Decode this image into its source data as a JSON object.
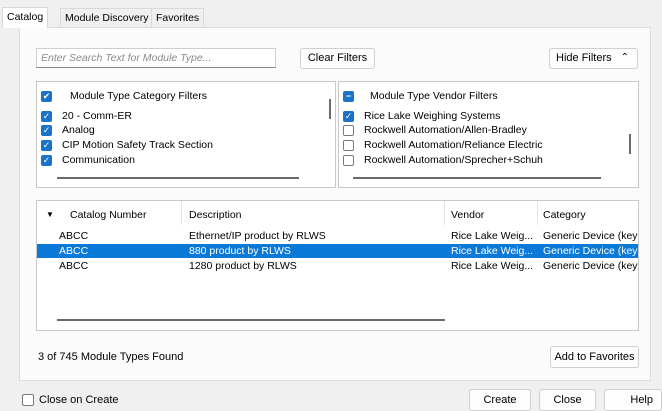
{
  "tabs": [
    "Catalog",
    "Module Discovery",
    "Favorites"
  ],
  "search": {
    "placeholder": "Enter Search Text for Module Type..."
  },
  "buttons": {
    "clear_filters": "Clear Filters",
    "hide_filters": "Hide Filters",
    "add_to_favorites": "Add to Favorites",
    "create": "Create",
    "close": "Close",
    "help": "Help"
  },
  "category_filter": {
    "header": "Module Type Category Filters",
    "items": [
      {
        "label": "20 - Comm-ER",
        "checked": true
      },
      {
        "label": "Analog",
        "checked": true
      },
      {
        "label": "CIP Motion Safety Track Section",
        "checked": true
      },
      {
        "label": "Communication",
        "checked": true
      }
    ]
  },
  "vendor_filter": {
    "header": "Module Type Vendor Filters",
    "items": [
      {
        "label": "Rice Lake Weighing Systems",
        "checked": true
      },
      {
        "label": "Rockwell Automation/Allen-Bradley",
        "checked": false
      },
      {
        "label": "Rockwell Automation/Reliance Electric",
        "checked": false
      },
      {
        "label": "Rockwell Automation/Sprecher+Schuh",
        "checked": false
      }
    ]
  },
  "table": {
    "columns": [
      "Catalog Number",
      "Description",
      "Vendor",
      "Category"
    ],
    "rows": [
      {
        "catalog": "ABCC",
        "description": "Ethernet/IP product by RLWS",
        "vendor": "Rice Lake Weig...",
        "category": "Generic Device (keya",
        "selected": false
      },
      {
        "catalog": "ABCC",
        "description": "880 product by RLWS",
        "vendor": "Rice Lake Weig...",
        "category": "Generic Device (keya",
        "selected": true
      },
      {
        "catalog": "ABCC",
        "description": "1280 product by RLWS",
        "vendor": "Rice Lake Weig...",
        "category": "Generic Device (keya",
        "selected": false
      }
    ]
  },
  "status_text": "3 of 745 Module Types Found",
  "close_on_create": {
    "label": "Close on Create",
    "checked": false
  },
  "colors": {
    "accent": "#1a73c8",
    "selection": "#0b79d8"
  }
}
